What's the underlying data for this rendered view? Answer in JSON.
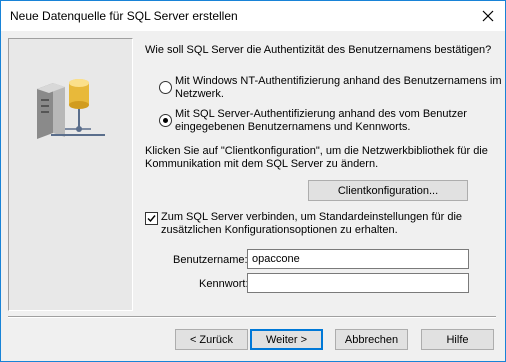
{
  "window": {
    "title": "Neue Datenquelle für SQL Server erstellen"
  },
  "auth": {
    "question": "Wie soll SQL Server die Authentizität des Benutzernamens bestätigen?",
    "option_nt_line1": "Mit Windows NT-Authentifizierung anhand des Benutzernamens im",
    "option_nt_line2": "Netzwerk.",
    "option_sql_line1": "Mit SQL Server-Authentifizierung anhand des vom Benutzer",
    "option_sql_line2": "eingegebenen Benutzernamens und Kennworts.",
    "selected": "sql"
  },
  "client": {
    "info_line1": "Klicken Sie auf \"Clientkonfiguration\", um die Netzwerkbibliothek für die",
    "info_line2": "Kommunikation mit dem SQL Server zu ändern.",
    "button_label": "Clientkonfiguration..."
  },
  "connect": {
    "checkbox_line1": "Zum SQL Server verbinden, um Standardeinstellungen für die",
    "checkbox_line2": "zusätzlichen Konfigurationsoptionen zu erhalten.",
    "checked": true
  },
  "login": {
    "username_label": "Benutzername:",
    "username_value": "opaccone",
    "password_label": "Kennwort:",
    "password_value": ""
  },
  "buttons": {
    "back": "< Zurück",
    "next": "Weiter >",
    "cancel": "Abbrechen",
    "help": "Hilfe"
  },
  "icons": {
    "close": "close-icon",
    "illustration": "server-database-icon"
  }
}
